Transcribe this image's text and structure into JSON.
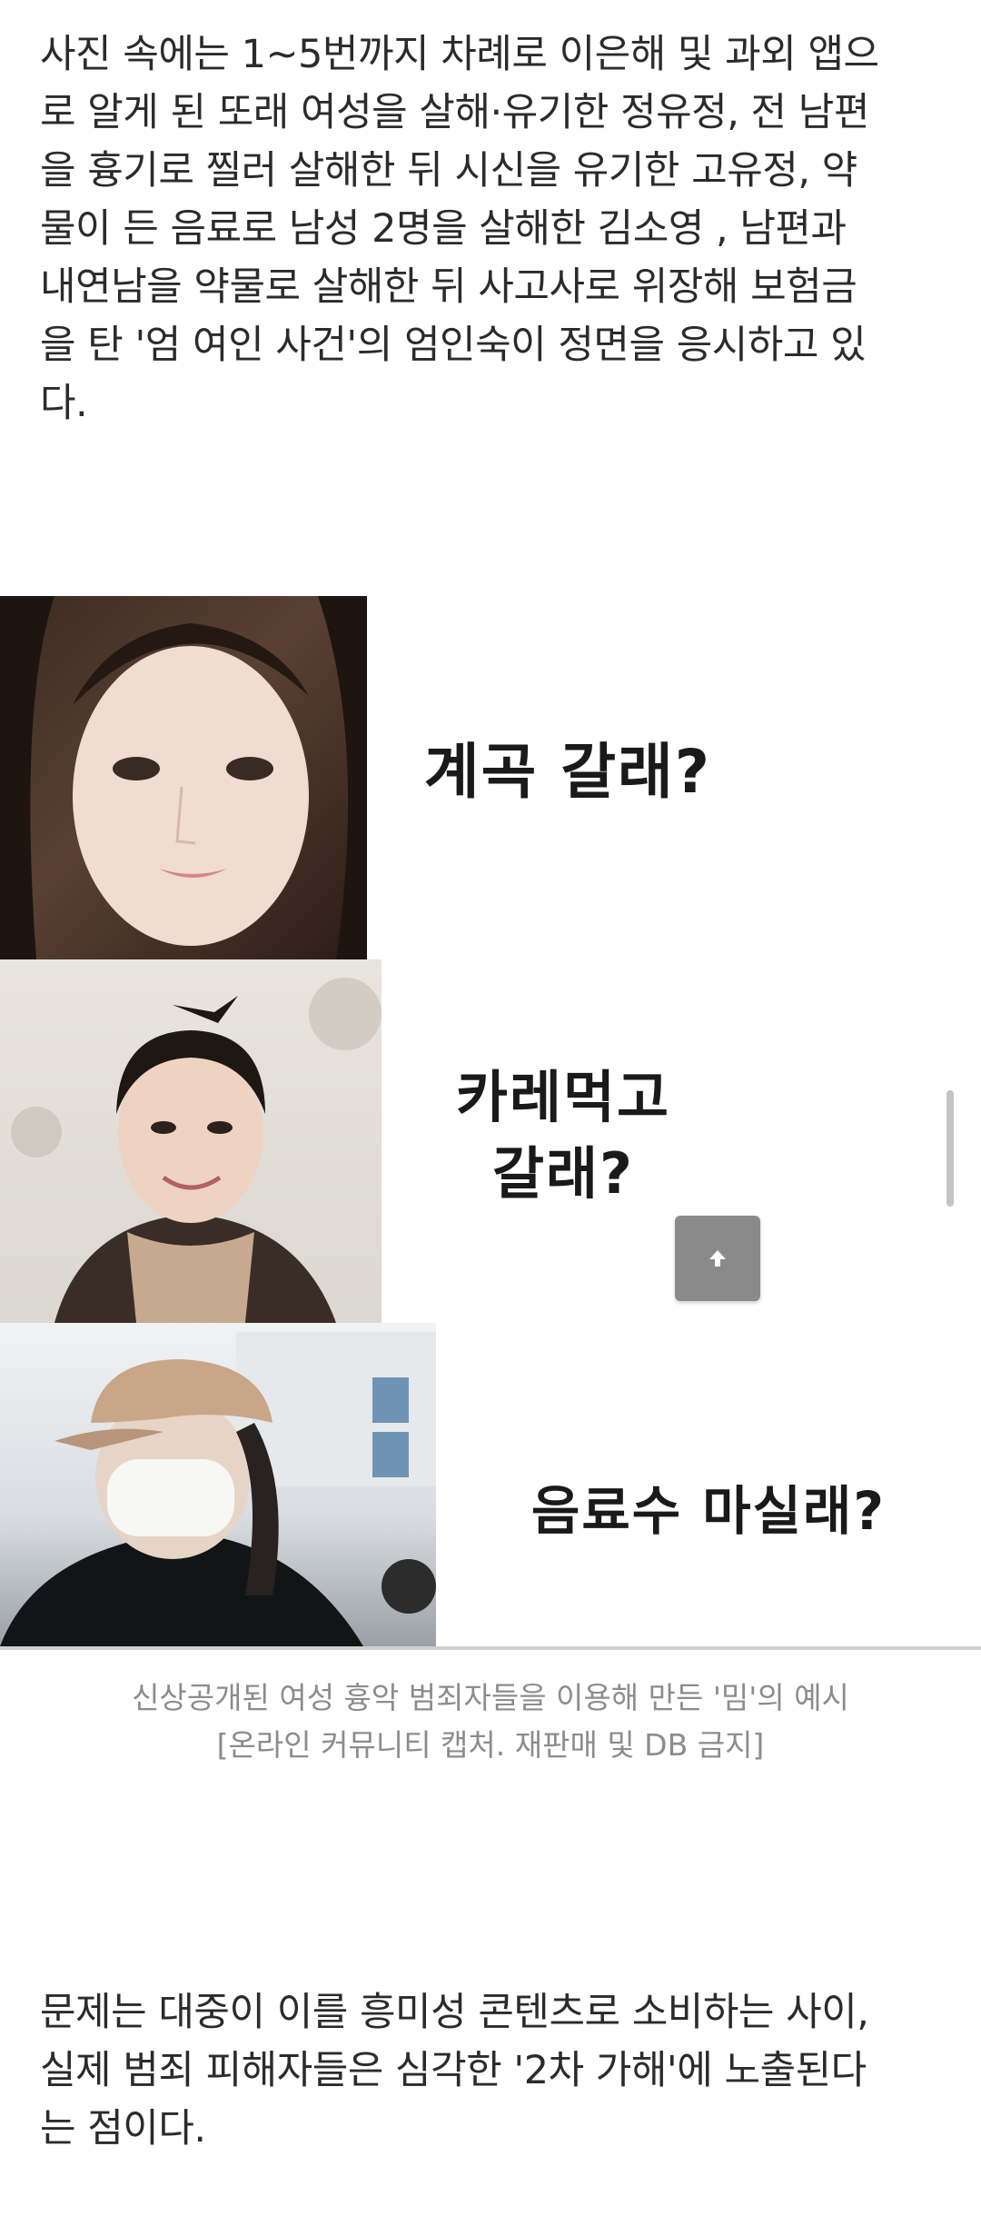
{
  "article": {
    "paragraph1": "사진 속에는 1~5번까지 차례로 이은해 및 과외 앱으\n로 알게 된 또래 여성을 살해·유기한 정유정, 전 남편\n을 흉기로 찔러 살해한 뒤 시신을 유기한 고유정, 약\n물이 든 음료로 남성 2명을 살해한 김소영 , 남편과\n내연남을 약물로 살해한 뒤 사고사로 위장해 보험금\n을 탄 '엄 여인 사건'의 엄인숙이 정면을 응시하고 있\n다.",
    "paragraph2": "문제는 대중이 이를 흥미성 콘텐츠로 소비하는 사이,\n실제 범죄 피해자들은 심각한 '2차 가해'에 노출된다\n는 점이다."
  },
  "meme": {
    "panels": [
      {
        "caption": "계곡 갈래?"
      },
      {
        "caption": "카레먹고\n갈래?"
      },
      {
        "caption": "음료수 마실래?"
      }
    ]
  },
  "figure": {
    "caption": "신상공개된 여성 흉악 범죄자들을 이용해 만든 '밈'의 예시\n[온라인 커뮤니티 캡처. 재판매 및 DB 금지]"
  },
  "icons": {
    "scroll_top": "arrow-up-icon"
  },
  "colors": {
    "body_text": "#2b2b2b",
    "caption_text": "#8c8c8c",
    "top_button": "#8a8a8a"
  }
}
